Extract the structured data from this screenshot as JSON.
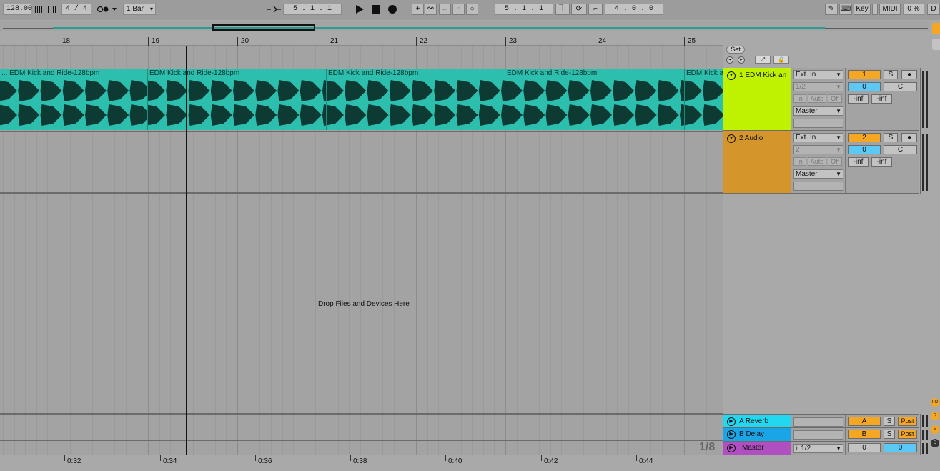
{
  "control_bar": {
    "tempo": "128.00",
    "signature": "4 / 4",
    "metronome_icon": "metronome-dots",
    "quantize": "1 Bar",
    "arrangement_position": "5 .   1 .   1",
    "loop_start": "5 .   1 .   1",
    "loop_length": "4 .   0 .   0",
    "key_label": "Key",
    "midi_label": "MIDI",
    "cpu_load": "0 %",
    "d_label": "D"
  },
  "ruler": {
    "bars": [
      "18",
      "19",
      "20",
      "21",
      "22",
      "23",
      "24",
      "25"
    ]
  },
  "set_button": "Set",
  "drop_hint": "Drop Files and Devices Here",
  "zoom_indicator": "1/8",
  "clips": [
    {
      "title": "... EDM Kick and Ride-128bpm"
    },
    {
      "title": "EDM Kick and Ride-128bpm"
    },
    {
      "title": "EDM Kick and Ride-128bpm"
    },
    {
      "title": "EDM Kick and Ride-128bpm"
    },
    {
      "title": "EDM Kick a"
    }
  ],
  "tracks": [
    {
      "name": "1 EDM Kick an",
      "color": "#bff200",
      "input_type": "Ext. In",
      "input_channel": "1/2",
      "monitor": [
        "In",
        "Auto",
        "Off"
      ],
      "output": "Master",
      "number": "1",
      "solo": "S",
      "volume": "0",
      "pan": "C",
      "meter_left": "-inf",
      "meter_right": "-inf"
    },
    {
      "name": "2 Audio",
      "color": "#d4962a",
      "input_type": "Ext. In",
      "input_channel": "2",
      "monitor": [
        "In",
        "Auto",
        "Off"
      ],
      "output": "Master",
      "number": "2",
      "solo": "S",
      "volume": "0",
      "pan": "C",
      "meter_left": "-inf",
      "meter_right": "-inf"
    }
  ],
  "returns": [
    {
      "name": "A Reverb",
      "color": "#22d8f0",
      "letter": "A",
      "solo": "S",
      "post": "Post"
    },
    {
      "name": "B Delay",
      "color": "#1aa6e6",
      "letter": "B",
      "solo": "S",
      "post": "Post"
    }
  ],
  "master": {
    "name": "Master",
    "color": "#b04fc0",
    "output": "1/2",
    "volume": "0",
    "pan": "0"
  },
  "time_ruler": {
    "labels": [
      "0:32",
      "0:34",
      "0:36",
      "0:38",
      "0:40",
      "0:42",
      "0:44"
    ]
  },
  "side_labels": [
    "I-O",
    "R",
    "M",
    "D"
  ],
  "colors": {
    "clip": "#2cbfae",
    "accent_orange": "#f5a623",
    "accent_blue": "#5bc8f5"
  }
}
